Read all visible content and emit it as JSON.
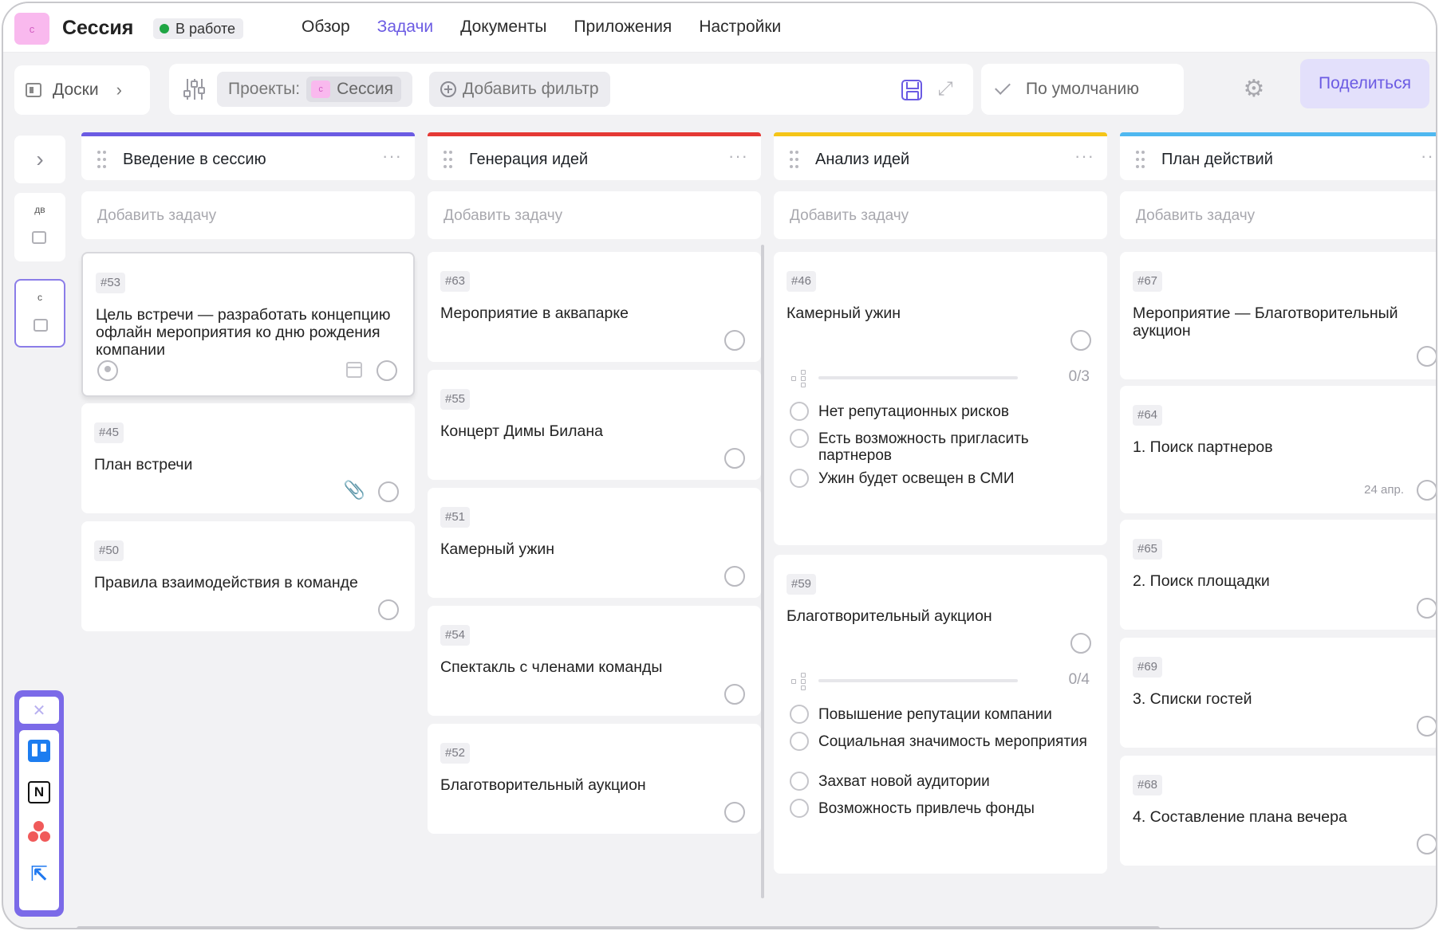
{
  "app": {
    "logo_letter": "c",
    "title": "Сессия",
    "status": "В работе",
    "status_color": "#1fa544",
    "accent_color": "#6b5be3"
  },
  "nav": [
    "Обзор",
    "Задачи",
    "Документы",
    "Приложения",
    "Настройки"
  ],
  "nav_active": "Задачи",
  "filterbar": {
    "boards_label": "Доски",
    "projects_label": "Проекты:",
    "project_letter": "c",
    "project_name": "Сессия",
    "add_filter_label": "Добавить фильтр",
    "default_view_label": "По умолчанию",
    "share_label": "Поделиться"
  },
  "rail": {
    "groups": [
      {
        "abbr": "дв"
      },
      {
        "abbr": "c"
      }
    ],
    "integrations": [
      "trello",
      "notion",
      "asana",
      "jira"
    ]
  },
  "board": {
    "add_task_placeholder": "Добавить задачу",
    "columns": [
      {
        "title": "Введение в сессию",
        "color": "#6b5be3",
        "cards": [
          {
            "id": "#53",
            "title": "Цель встречи — разработать концепцию офлайн мероприятия ко дню рождения компании",
            "selected": true
          },
          {
            "id": "#45",
            "title": "План встречи",
            "attachment": true
          },
          {
            "id": "#50",
            "title": "Правила взаимодействия в команде"
          }
        ]
      },
      {
        "title": "Генерация идей",
        "color": "#e53935",
        "cards": [
          {
            "id": "#63",
            "title": "Мероприятие в аквапарке"
          },
          {
            "id": "#55",
            "title": "Концерт Димы Билана"
          },
          {
            "id": "#51",
            "title": "Камерный ужин"
          },
          {
            "id": "#54",
            "title": "Спектакль с членами команды"
          },
          {
            "id": "#52",
            "title": "Благотворительный аукцион"
          }
        ]
      },
      {
        "title": "Анализ идей",
        "color": "#f5c518",
        "cards": [
          {
            "id": "#46",
            "title": "Камерный ужин",
            "subtasks_done": 0,
            "subtasks_total": 3,
            "subtasks_label": "0/3",
            "checklist": [
              "Нет репутационных рисков",
              "Есть возможность пригласить партнеров",
              "Ужин будет освещен в СМИ"
            ]
          },
          {
            "id": "#59",
            "title": "Благотворительный аукцион",
            "subtasks_done": 0,
            "subtasks_total": 4,
            "subtasks_label": "0/4",
            "checklist": [
              "Повышение репутации компании",
              "Социальная значимость мероприятия",
              "Захват новой аудитории",
              "Возможность привлечь фонды"
            ]
          }
        ]
      },
      {
        "title": "План действий",
        "color": "#4fb8f0",
        "cards": [
          {
            "id": "#67",
            "title": "Мероприятие — Благотворительный аукцион"
          },
          {
            "id": "#64",
            "title": "1. Поиск партнеров",
            "date": "24 апр."
          },
          {
            "id": "#65",
            "title": "2. Поиск площадки"
          },
          {
            "id": "#69",
            "title": "3. Списки гостей"
          },
          {
            "id": "#68",
            "title": "4. Составление плана вечера"
          }
        ]
      }
    ]
  }
}
